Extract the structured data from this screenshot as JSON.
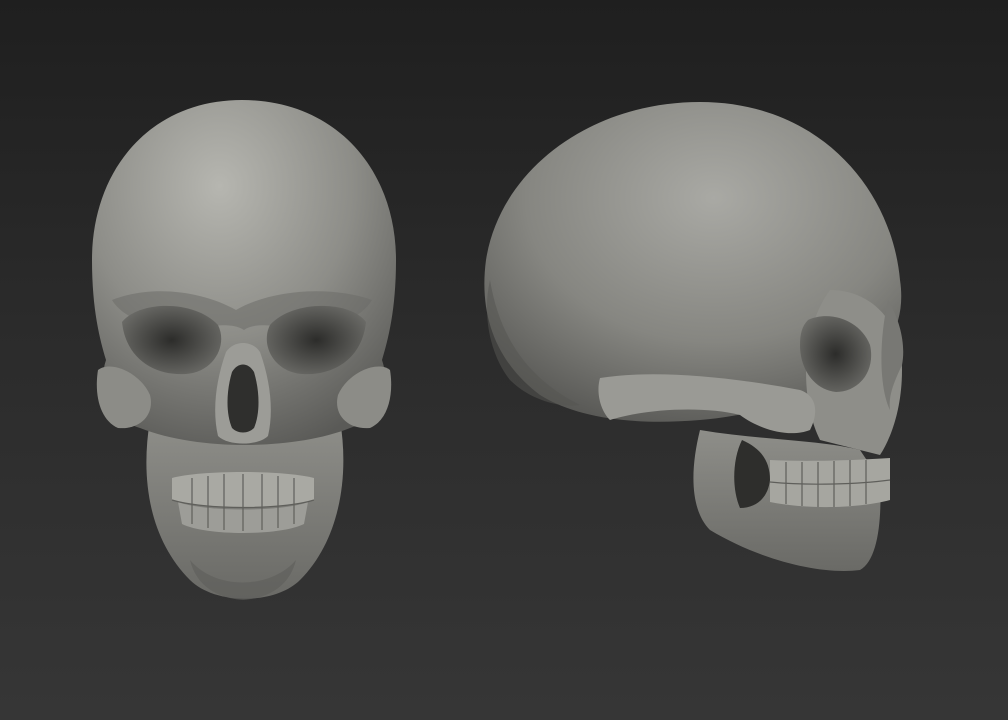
{
  "scene": {
    "background_top": "#1f1f1f",
    "background_bottom": "#363636",
    "material_base": "#8a8a85",
    "material_highlight": "#b4b4ae",
    "material_shadow": "#3a3a38"
  },
  "models": [
    {
      "view": "front",
      "icon": "skull-front-render"
    },
    {
      "view": "side",
      "icon": "skull-side-render"
    }
  ]
}
